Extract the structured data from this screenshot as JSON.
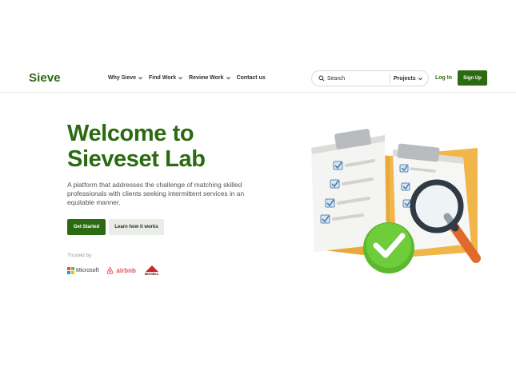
{
  "nav": {
    "logo": "Sieve",
    "menu": [
      {
        "label": "Why Sieve",
        "has_dropdown": true
      },
      {
        "label": "Find Work",
        "has_dropdown": true
      },
      {
        "label": "Review Work",
        "has_dropdown": true
      },
      {
        "label": "Contact us",
        "has_dropdown": false
      }
    ],
    "search": {
      "placeholder": "Search",
      "scope": "Projects",
      "icon": "search-icon"
    },
    "login": "Log In",
    "signup": "Sign Up"
  },
  "hero": {
    "title": "Welcome to Sieveset Lab",
    "description": "A platform that addresses the challenge of matching skilled professionals with clients seeking intermittent services in an equitable manner.",
    "primary_button": "Get Started",
    "secondary_button": "Learn how it works",
    "trusted_label": "Trusted by",
    "trusted_logos": [
      {
        "name": "Microsoft",
        "text": "Microsoft"
      },
      {
        "name": "Airbnb",
        "text": "airbnb"
      },
      {
        "name": "Bissell",
        "text": "BISSELL"
      }
    ]
  },
  "colors": {
    "brand": "#2c6a12",
    "check": "#5cb82e",
    "airbnb": "#e8505b",
    "bissell": "#c62828"
  }
}
